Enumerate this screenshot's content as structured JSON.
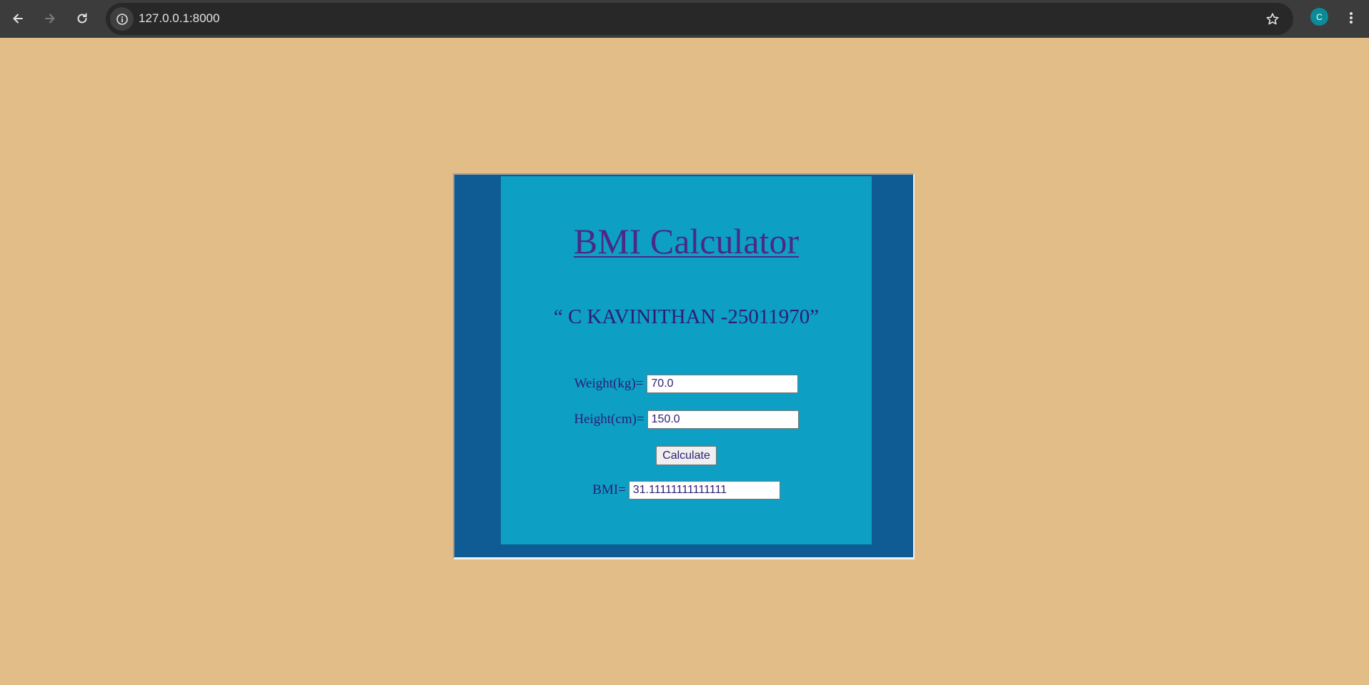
{
  "browser": {
    "url": "127.0.0.1:8000",
    "profile_initial": "C",
    "icons": {
      "back": "back-arrow-icon",
      "forward": "forward-arrow-icon",
      "reload": "reload-icon",
      "site_info": "info-icon",
      "bookmark": "star-icon",
      "menu": "kebab-menu-icon"
    }
  },
  "page": {
    "title": "BMI Calculator",
    "subtitle": "“ C KAVINITHAN -25011970”",
    "weight_label": "Weight(kg)=",
    "weight_value": "70.0",
    "height_label": "Height(cm)=",
    "height_value": "150.0",
    "calculate_label": "Calculate",
    "bmi_label": "BMI=",
    "bmi_value": "31.11111111111111"
  },
  "colors": {
    "page_background": "#e3bd87",
    "outer_panel": "#0f5b93",
    "inner_panel": "#0d9fc4",
    "text": "#2e1d73",
    "title_link": "#4a2a86",
    "chrome": "#3c3c3c",
    "avatar": "#0b8a98"
  }
}
